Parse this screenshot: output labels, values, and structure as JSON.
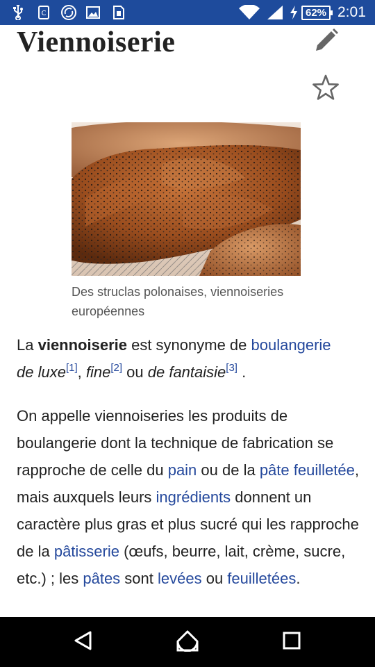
{
  "status_bar": {
    "battery_percent": "62%",
    "time": "2:01",
    "icons": [
      "usb-icon",
      "clipboard-icon",
      "sync-icon",
      "image-icon",
      "sim-icon",
      "wifi-icon",
      "signal-icon",
      "charging-icon",
      "battery-icon"
    ]
  },
  "article": {
    "title": "Viennoiserie",
    "figure_caption_line1": "Des struclas polonaises, viennoiseries",
    "figure_caption_line2": "européennes",
    "p1": {
      "t1": "La ",
      "bold": "viennoiserie",
      "t2": " est synonyme de ",
      "link_boulangerie": "boulangerie",
      "i1": "de luxe",
      "ref1": "[1]",
      "t3": ", ",
      "i2": "fine",
      "ref2": "[2]",
      "t4": " ou ",
      "i3": "de fantaisie",
      "ref3": "[3]",
      "t5": " ."
    },
    "p2": {
      "t1": "On appelle viennoiseries les produits de boulangerie dont la technique de fabrication se rapproche de celle du ",
      "link_pain": "pain",
      "t2": " ou de la ",
      "link_pate_feuilletee": "pâte feuilletée",
      "t3": ", mais auxquels leurs ",
      "link_ingredients": "ingrédients",
      "t4": " donnent un caractère plus gras et plus sucré qui les rapproche de la ",
      "link_patisserie": "pâtisserie",
      "t5": " (œufs, beurre, lait, crème, sucre, etc.) ; les ",
      "link_pates": "pâtes",
      "t6": " sont ",
      "link_levees": "levées",
      "t7": " ou ",
      "link_feuilletees": "feuilletées",
      "t8": "."
    }
  },
  "nav_bar": {
    "buttons": [
      "back-icon",
      "home-icon",
      "recents-icon"
    ]
  },
  "colors": {
    "status_bar": "#1e4b9c",
    "link": "#24489c",
    "text": "#222222",
    "caption": "#555555",
    "nav_bar": "#000000"
  }
}
